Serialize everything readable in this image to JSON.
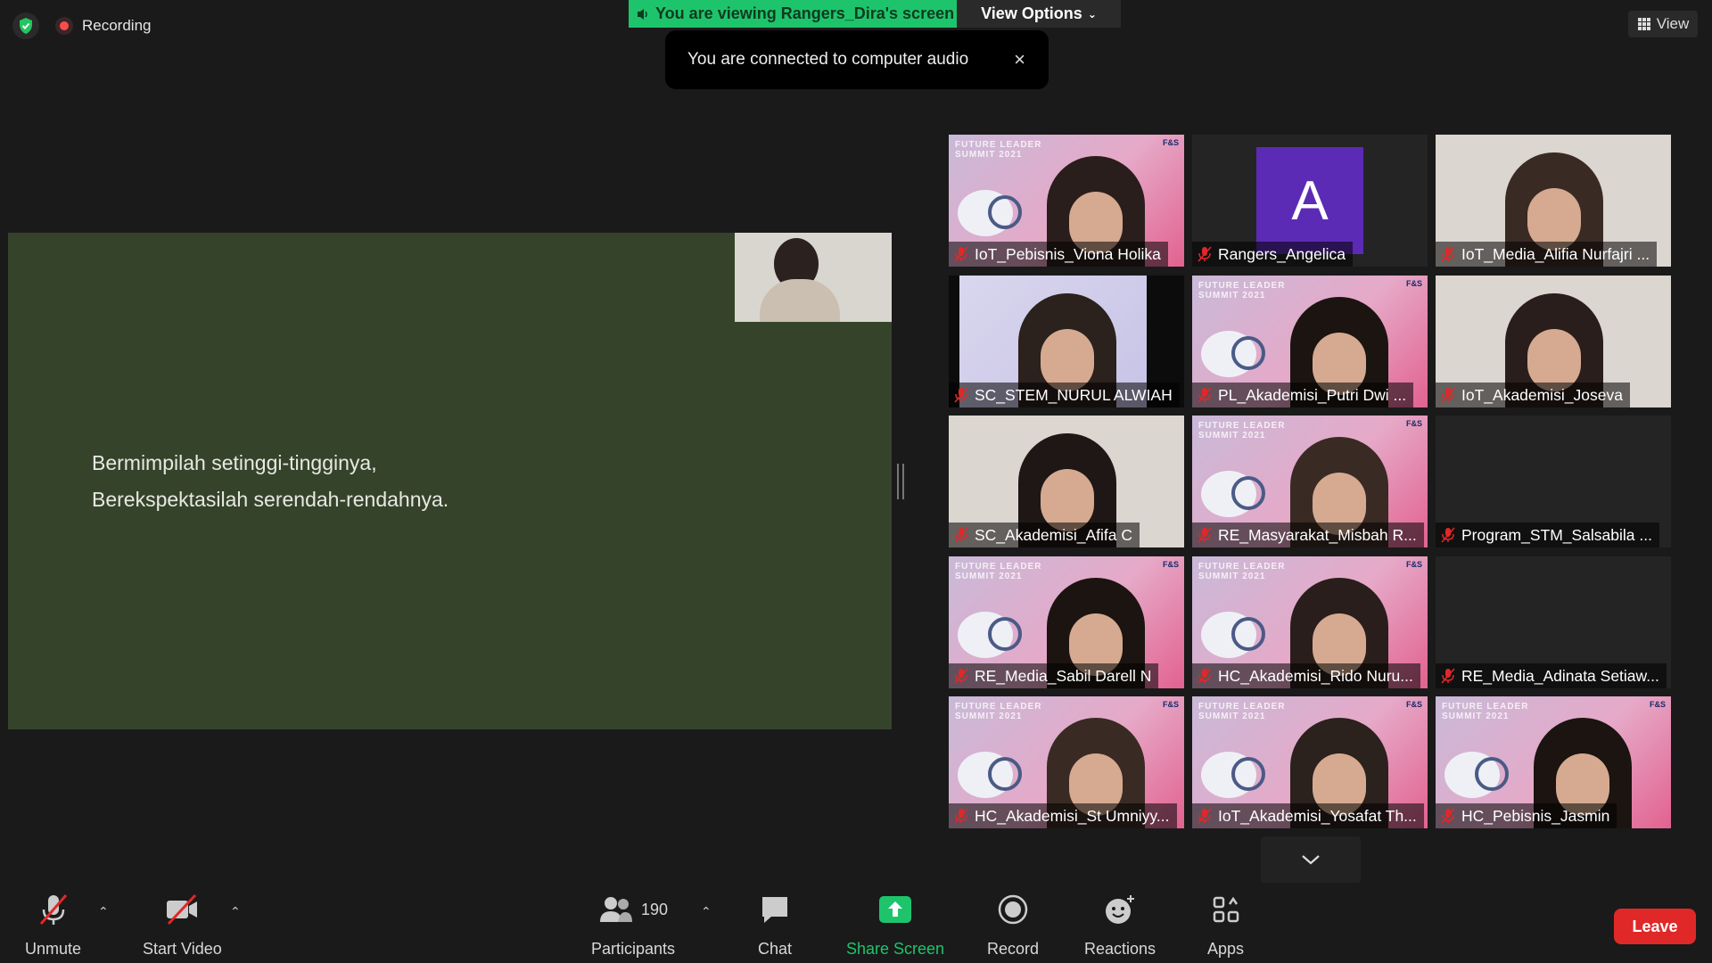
{
  "top": {
    "recording_label": "Recording",
    "viewing_banner": "You are viewing Rangers_Dira's screen",
    "view_options": "View Options",
    "view_button": "View"
  },
  "toast": {
    "message": "You are connected to computer audio",
    "close": "×"
  },
  "shared_screen": {
    "line1": "Bermimpilah setinggi-tingginya,",
    "line2": "Berekspektasilah serendah-rendahnya."
  },
  "tile_banner": {
    "line1": "FUTURE LEADER",
    "line2": "SUMMIT 2021",
    "logo": "F&S"
  },
  "avatar_letter": "A",
  "participants": [
    "IoT_Pebisnis_Viona Holika",
    "Rangers_Angelica",
    "IoT_Media_Alifia Nurfajri ...",
    "SC_STEM_NURUL ALWIAH",
    "PL_Akademisi_Putri Dwi ...",
    "IoT_Akademisi_Joseva",
    "SC_Akademisi_Afifa C",
    "RE_Masyarakat_Misbah R...",
    "Program_STM_Salsabila ...",
    "RE_Media_Sabil Darell N",
    "HC_Akademisi_Rido Nuru...",
    "RE_Media_Adinata Setiaw...",
    "HC_Akademisi_St Umniyy...",
    "IoT_Akademisi_Yosafat Th...",
    "HC_Pebisnis_Jasmin"
  ],
  "toolbar": {
    "unmute": "Unmute",
    "start_video": "Start Video",
    "participants_count": "190",
    "participants": "Participants",
    "chat": "Chat",
    "share_screen": "Share Screen",
    "record": "Record",
    "reactions": "Reactions",
    "apps": "Apps",
    "leave": "Leave"
  },
  "colors": {
    "share_green": "#1ec46b",
    "leave_red": "#e02828",
    "slide_bg": "#36432b",
    "avatar_purple": "#5b2bb5"
  }
}
